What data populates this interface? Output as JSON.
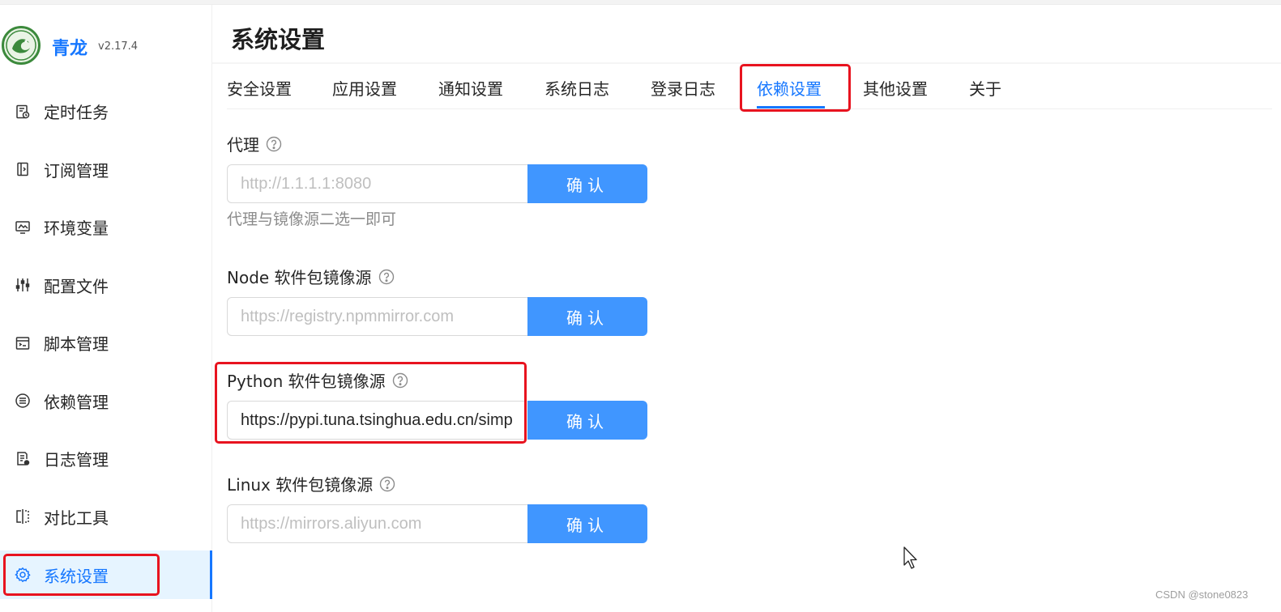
{
  "app": {
    "name": "青龙",
    "version": "v2.17.4"
  },
  "sidebar": {
    "items": [
      {
        "label": "定时任务",
        "icon": "scheduled-task-icon"
      },
      {
        "label": "订阅管理",
        "icon": "subscription-icon"
      },
      {
        "label": "环境变量",
        "icon": "environment-icon"
      },
      {
        "label": "配置文件",
        "icon": "sliders-icon"
      },
      {
        "label": "脚本管理",
        "icon": "script-icon"
      },
      {
        "label": "依赖管理",
        "icon": "dependency-list-icon"
      },
      {
        "label": "日志管理",
        "icon": "log-icon"
      },
      {
        "label": "对比工具",
        "icon": "diff-icon"
      },
      {
        "label": "系统设置",
        "icon": "gear-icon",
        "active": true
      }
    ]
  },
  "page": {
    "title": "系统设置"
  },
  "tabs": [
    {
      "label": "安全设置"
    },
    {
      "label": "应用设置"
    },
    {
      "label": "通知设置"
    },
    {
      "label": "系统日志"
    },
    {
      "label": "登录日志"
    },
    {
      "label": "依赖设置",
      "active": true
    },
    {
      "label": "其他设置"
    },
    {
      "label": "关于"
    }
  ],
  "form": {
    "proxy": {
      "label": "代理",
      "placeholder": "http://1.1.1.1:8080",
      "value": "",
      "button": "确认",
      "hint": "代理与镜像源二选一即可"
    },
    "node": {
      "label": "Node 软件包镜像源",
      "placeholder": "https://registry.npmmirror.com",
      "value": "",
      "button": "确认"
    },
    "python": {
      "label": "Python 软件包镜像源",
      "placeholder": "",
      "value": "https://pypi.tuna.tsinghua.edu.cn/simple",
      "button": "确认"
    },
    "linux": {
      "label": "Linux 软件包镜像源",
      "placeholder": "https://mirrors.aliyun.com",
      "value": "",
      "button": "确认"
    }
  },
  "watermark": "CSDN @stone0823",
  "colors": {
    "primary": "#1677ff",
    "button": "#4096ff",
    "highlight": "#e8131f",
    "active_bg": "#e6f4ff"
  }
}
